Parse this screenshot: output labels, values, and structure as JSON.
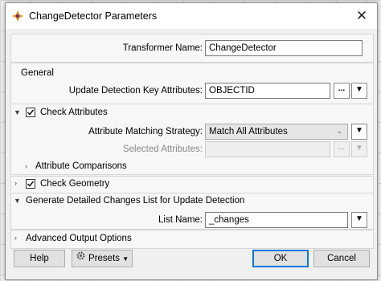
{
  "window": {
    "title": "ChangeDetector Parameters",
    "close_glyph": "✕"
  },
  "transformer_name": {
    "label": "Transformer Name:",
    "value": "ChangeDetector"
  },
  "general": {
    "label": "General",
    "update_keys": {
      "label": "Update Detection Key Attributes:",
      "value": "OBJECTID",
      "browse": "...",
      "menu": "▼"
    }
  },
  "check_attributes": {
    "label": "Check Attributes",
    "checked": true,
    "strategy": {
      "label": "Attribute Matching Strategy:",
      "value": "Match All Attributes",
      "chevron": "⌄",
      "menu": "▼"
    },
    "selected": {
      "label": "Selected Attributes:",
      "value": "",
      "browse": "...",
      "menu": "▼"
    },
    "comparisons": {
      "label": "Attribute Comparisons"
    }
  },
  "check_geometry": {
    "label": "Check Geometry",
    "checked": true
  },
  "detailed_changes": {
    "label": "Generate Detailed Changes List for Update Detection",
    "list_name": {
      "label": "List Name:",
      "value": "_changes",
      "menu": "▼"
    }
  },
  "advanced": {
    "label": "Advanced Output Options"
  },
  "footer": {
    "help": "Help",
    "presets": "Presets",
    "ok": "OK",
    "cancel": "Cancel"
  },
  "colors": {
    "accent": "#0078d7",
    "dialog_bg": "#f0f0f0",
    "group_bg": "#f7f7f7"
  }
}
